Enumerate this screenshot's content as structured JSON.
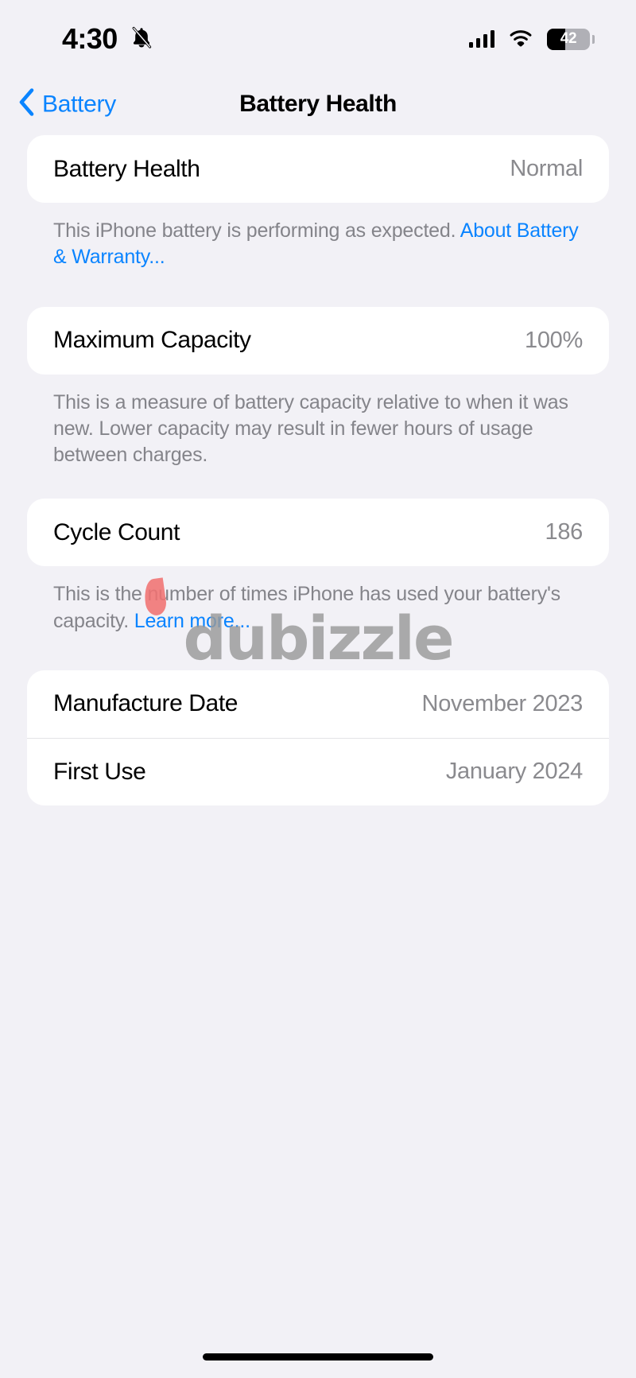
{
  "status_bar": {
    "time": "4:30",
    "silent_icon": "bell-slash-icon",
    "cellular_icon": "cellular-bars-icon",
    "wifi_icon": "wifi-icon",
    "battery_percent": "42",
    "battery_level": 42
  },
  "nav": {
    "back_label": "Battery",
    "back_icon": "chevron-left-icon",
    "title": "Battery Health"
  },
  "sections": {
    "battery_health": {
      "label": "Battery Health",
      "value": "Normal",
      "footnote_text": "This iPhone battery is performing as expected. ",
      "footnote_link": "About Battery & Warranty..."
    },
    "maximum_capacity": {
      "label": "Maximum Capacity",
      "value": "100%",
      "footnote_text": "This is a measure of battery capacity relative to when it was new. Lower capacity may result in fewer hours of usage between charges."
    },
    "cycle_count": {
      "label": "Cycle Count",
      "value": "186",
      "footnote_text": "This is the number of times iPhone has used your battery's capacity. ",
      "footnote_link": "Learn more..."
    },
    "dates": {
      "manufacture_label": "Manufacture Date",
      "manufacture_value": "November 2023",
      "first_use_label": "First Use",
      "first_use_value": "January 2024"
    }
  },
  "watermark": {
    "text": "dubizzle"
  },
  "colors": {
    "accent_blue": "#0a84ff",
    "page_background": "#f2f1f6",
    "card_background": "#ffffff",
    "secondary_text": "#8a8a8e"
  }
}
